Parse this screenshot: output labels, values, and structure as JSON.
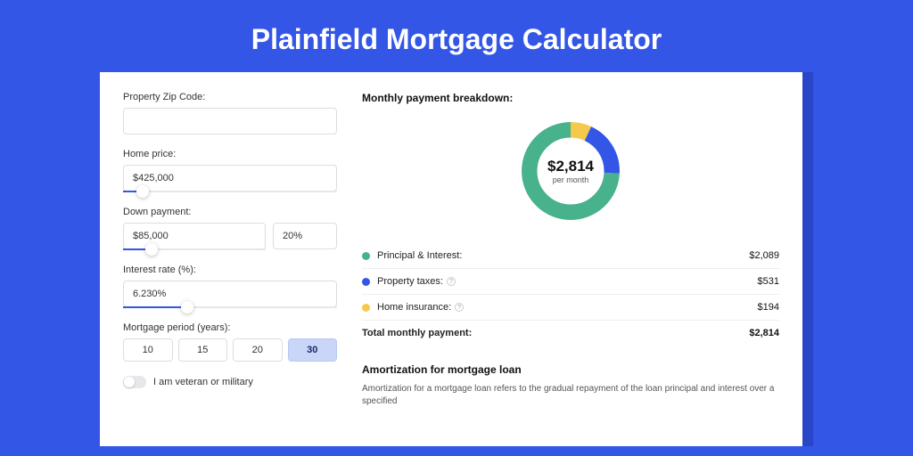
{
  "title": "Plainfield Mortgage Calculator",
  "form": {
    "zip": {
      "label": "Property Zip Code:",
      "value": ""
    },
    "home_price": {
      "label": "Home price:",
      "value": "$425,000",
      "slider_pct": 9
    },
    "down_payment": {
      "label": "Down payment:",
      "amount": "$85,000",
      "pct": "20%",
      "slider_pct": 20
    },
    "interest": {
      "label": "Interest rate (%):",
      "value": "6.230%",
      "slider_pct": 30
    },
    "period": {
      "label": "Mortgage period (years):",
      "options": [
        "10",
        "15",
        "20",
        "30"
      ],
      "selected": "30"
    },
    "veteran": {
      "label": "I am veteran or military",
      "checked": false
    }
  },
  "breakdown": {
    "title": "Monthly payment breakdown:",
    "center_amount": "$2,814",
    "center_sub": "per month",
    "items": [
      {
        "label": "Principal & Interest:",
        "value": "$2,089",
        "color": "#47B28B",
        "info": false
      },
      {
        "label": "Property taxes:",
        "value": "$531",
        "color": "#3356E6",
        "info": true
      },
      {
        "label": "Home insurance:",
        "value": "$194",
        "color": "#F5C94B",
        "info": true
      }
    ],
    "total": {
      "label": "Total monthly payment:",
      "value": "$2,814"
    }
  },
  "chart_data": {
    "type": "pie",
    "title": "Monthly payment breakdown",
    "series": [
      {
        "name": "Principal & Interest",
        "value": 2089,
        "color": "#47B28B"
      },
      {
        "name": "Property taxes",
        "value": 531,
        "color": "#3356E6"
      },
      {
        "name": "Home insurance",
        "value": 194,
        "color": "#F5C94B"
      }
    ],
    "total": 2814,
    "center_label": "$2,814 per month"
  },
  "amortization": {
    "title": "Amortization for mortgage loan",
    "text": "Amortization for a mortgage loan refers to the gradual repayment of the loan principal and interest over a specified"
  }
}
